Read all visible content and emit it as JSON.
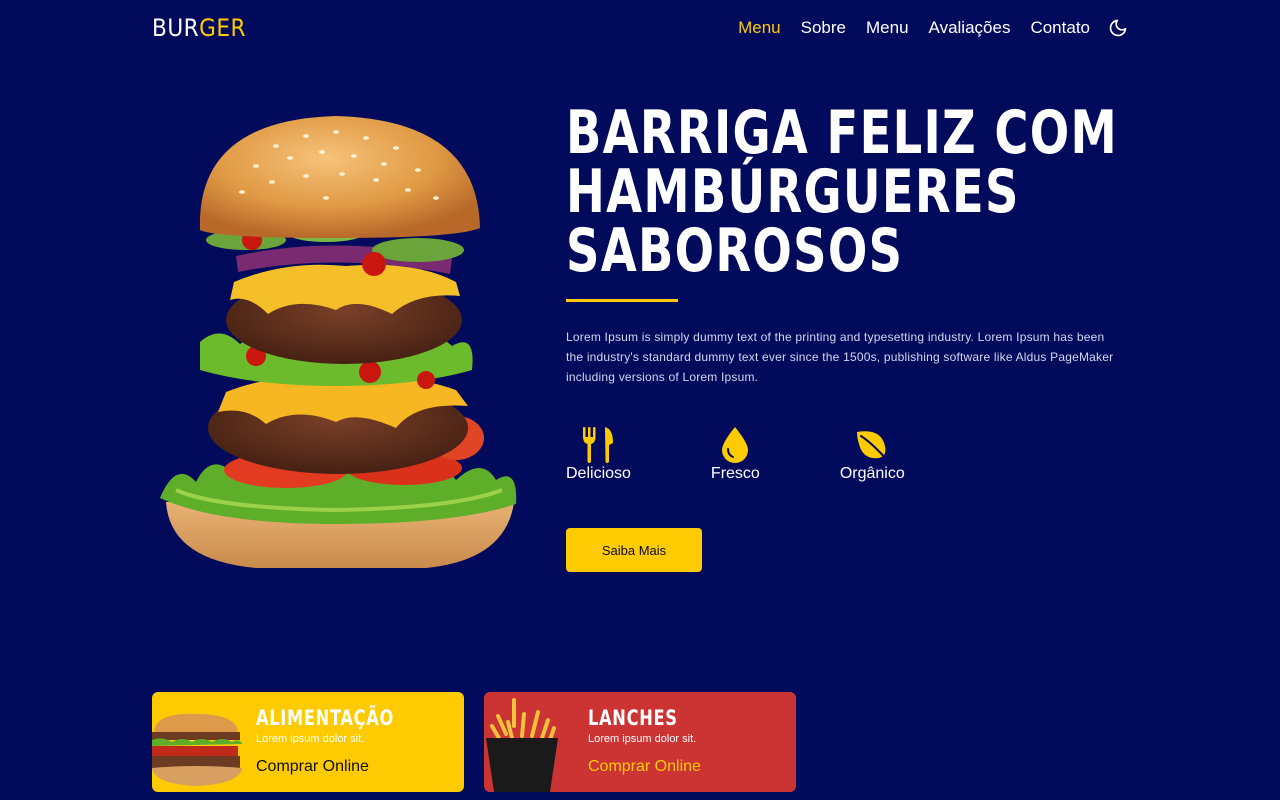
{
  "brand": {
    "part1": "BUR",
    "part2": "GER"
  },
  "nav": {
    "items": [
      {
        "label": "Menu",
        "active": true
      },
      {
        "label": "Sobre",
        "active": false
      },
      {
        "label": "Menu",
        "active": false
      },
      {
        "label": "Avaliações",
        "active": false
      },
      {
        "label": "Contato",
        "active": false
      }
    ],
    "theme_toggle_icon": "moon-icon"
  },
  "hero": {
    "title_line1": "BARRIGA FELIZ COM",
    "title_line2": "HAMBÚRGUERES",
    "title_line3": "SABOROSOS",
    "description": "Lorem Ipsum is simply dummy text of the printing and typesetting industry. Lorem Ipsum has been the industry's standard dummy text ever since the 1500s, publishing software like Aldus PageMaker including versions of Lorem Ipsum.",
    "features": [
      {
        "label": "Delicioso",
        "icon": "fork-knife-icon"
      },
      {
        "label": "Fresco",
        "icon": "droplet-icon"
      },
      {
        "label": "Orgânico",
        "icon": "leaf-icon"
      }
    ],
    "button_label": "Saiba Mais"
  },
  "cards": [
    {
      "title": "ALIMENTAÇÃO",
      "subtitle": "Lorem ipsum dolor sit.",
      "link": "Comprar Online",
      "color": "#fecb02"
    },
    {
      "title": "LANCHES",
      "subtitle": "Lorem ipsum dolor sit.",
      "link": "Comprar Online",
      "color": "#cc3333"
    }
  ],
  "colors": {
    "background": "#020a5c",
    "accent": "#fecb02",
    "red": "#cc3333"
  }
}
